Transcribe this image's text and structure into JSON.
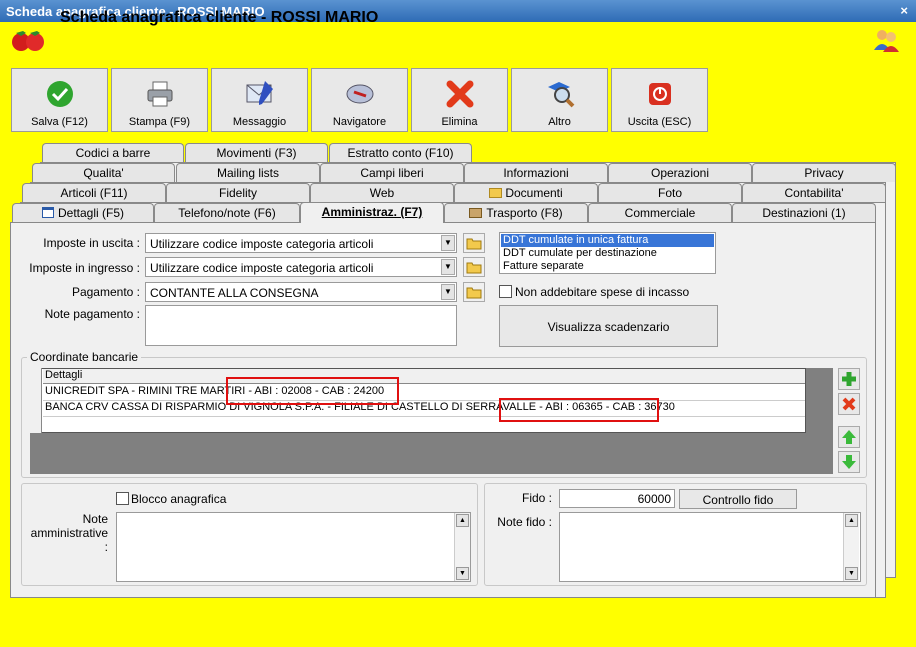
{
  "window": {
    "title": "Scheda anagrafica cliente - ROSSI MARIO",
    "close": "×"
  },
  "header": {
    "title": "Scheda anagrafica cliente - ROSSI MARIO"
  },
  "toolbar": [
    {
      "label": "Salva (F12)",
      "icon": "check-icon"
    },
    {
      "label": "Stampa (F9)",
      "icon": "printer-icon"
    },
    {
      "label": "Messaggio",
      "icon": "message-icon"
    },
    {
      "label": "Navigatore",
      "icon": "compass-icon"
    },
    {
      "label": "Elimina",
      "icon": "delete-icon"
    },
    {
      "label": "Altro",
      "icon": "magnifier-icon"
    },
    {
      "label": "Uscita (ESC)",
      "icon": "exit-icon"
    }
  ],
  "tabs": {
    "row1": [
      "Codici a barre",
      "Movimenti (F3)",
      "Estratto conto (F10)"
    ],
    "row2": [
      "Qualita'",
      "Mailing lists",
      "Campi liberi",
      "Informazioni",
      "Operazioni",
      "Privacy"
    ],
    "row3": [
      "Articoli (F11)",
      "Fidelity",
      "Web",
      "Documenti",
      "Foto",
      "Contabilita'"
    ],
    "row4": [
      "Dettagli (F5)",
      "Telefono/note (F6)",
      "Amministraz. (F7)",
      "Trasporto (F8)",
      "Commerciale",
      "Destinazioni (1)"
    ]
  },
  "form": {
    "imposte_uscita_label": "Imposte in uscita :",
    "imposte_uscita_value": "Utilizzare codice imposte categoria articoli",
    "imposte_ingresso_label": "Imposte in ingresso :",
    "imposte_ingresso_value": "Utilizzare codice imposte categoria articoli",
    "pagamento_label": "Pagamento :",
    "pagamento_value": "CONTANTE ALLA CONSEGNA",
    "note_pagamento_label": "Note pagamento :",
    "ddt_options": [
      "DDT cumulate in unica fattura",
      "DDT cumulate per destinazione",
      "Fatture separate"
    ],
    "ddt_selected": 0,
    "non_addebitare_label": "Non addebitare spese di incasso",
    "visualizza_button": "Visualizza scadenzario"
  },
  "bank": {
    "group_label": "Coordinate bancarie",
    "column": "Dettagli",
    "rows": [
      "UNICREDIT SPA - RIMINI TRE MARTIRI - ABI : 02008 - CAB : 24200",
      "BANCA CRV CASSA DI RISPARMIO DI VIGNOLA S.P.A. - FILIALE DI CASTELLO DI SERRAVALLE - ABI : 06365 - CAB : 36730"
    ]
  },
  "admin": {
    "blocco_label": "Blocco anagrafica",
    "note_amm_label": "Note amministrative :",
    "fido_label": "Fido :",
    "fido_value": "60000",
    "controllo_fido": "Controllo fido",
    "note_fido_label": "Note fido :"
  }
}
